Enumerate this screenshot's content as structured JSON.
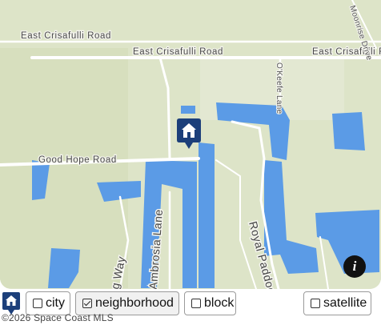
{
  "map": {
    "roads": {
      "east_crisafulli_1": "East Crisafulli Road",
      "east_crisafulli_2": "East Crisafulli Road",
      "east_crisafulli_3": "East Crisafulli Road",
      "okeefe_lane": "O'Keefe Lane",
      "moonrise_drive": "Moonrise Drive",
      "good_hope_road": "Good Hope Road",
      "ambrosia_lane": "Ambrosia Lane",
      "royal_paddock": "Royal Paddock",
      "partial_way": "g Way"
    },
    "marker_icon": "house-marker-icon",
    "info_icon": "info-icon",
    "info_glyph": "i",
    "colors": {
      "land": "#dde4c8",
      "water": "#5b9be6",
      "road": "#ffffff",
      "marker": "#1c3f7a"
    }
  },
  "controls": {
    "logo_icon": "house-pin-logo-icon",
    "city_label": "city",
    "city_checked": false,
    "neighborhood_label": "neighborhood",
    "neighborhood_checked": true,
    "block_label": "block",
    "block_checked": false,
    "satellite_label": "satellite",
    "satellite_checked": false
  },
  "copyright": "©2026 Space Coast MLS"
}
